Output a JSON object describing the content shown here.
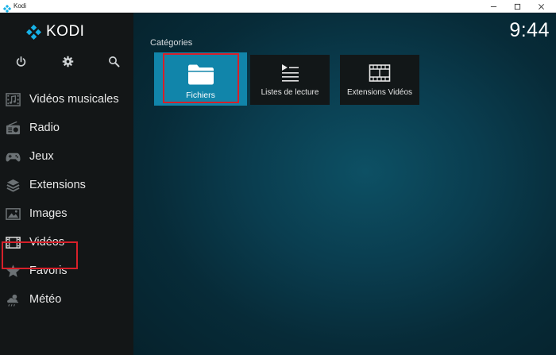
{
  "window": {
    "title": "Kodi",
    "app_icon": "kodi-logo-icon"
  },
  "header": {
    "logo_text": "KODI",
    "clock": "9:44"
  },
  "system_buttons": [
    {
      "name": "power",
      "icon": "power-icon"
    },
    {
      "name": "settings",
      "icon": "gear-icon"
    },
    {
      "name": "search",
      "icon": "search-icon"
    }
  ],
  "sidebar": {
    "items": [
      {
        "label": "Vidéos musicales",
        "icon": "music-video-icon"
      },
      {
        "label": "Radio",
        "icon": "radio-icon"
      },
      {
        "label": "Jeux",
        "icon": "gamepad-icon"
      },
      {
        "label": "Extensions",
        "icon": "addons-box-icon"
      },
      {
        "label": "Images",
        "icon": "picture-icon"
      },
      {
        "label": "Vidéos",
        "icon": "film-icon",
        "highlighted": true
      },
      {
        "label": "Favoris",
        "icon": "star-icon"
      },
      {
        "label": "Météo",
        "icon": "weather-icon"
      }
    ]
  },
  "content": {
    "section_title": "Catégories",
    "tiles": [
      {
        "label": "Fichiers",
        "icon": "folder-icon",
        "focused": true,
        "highlighted": true
      },
      {
        "label": "Listes de lecture",
        "icon": "playlist-icon"
      },
      {
        "label": "Extensions Vidéos",
        "icon": "film-strip-icon"
      }
    ]
  },
  "colors": {
    "accent": "#1185aa",
    "highlight_box": "#d6202a",
    "sidebar_bg": "#131617",
    "background": "#0a3d4f"
  }
}
